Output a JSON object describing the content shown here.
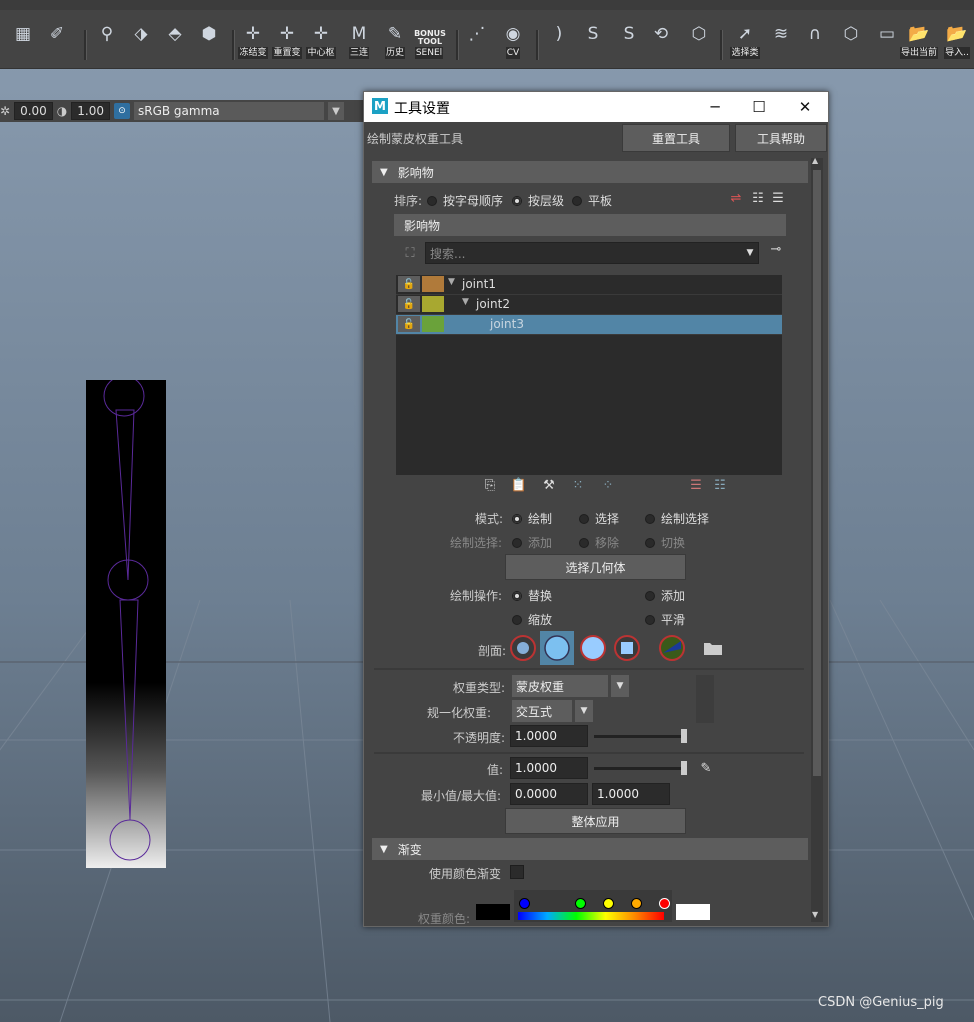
{
  "shelf": {
    "buttons": [
      {
        "icon": "grid-icon",
        "label": ""
      },
      {
        "icon": "paint-brush-icon",
        "label": ""
      },
      {
        "icon": "pivot-icon",
        "label": ""
      },
      {
        "icon": "cube-move-icon",
        "label": ""
      },
      {
        "icon": "plane-icon",
        "label": ""
      },
      {
        "icon": "cube-icon",
        "label": ""
      },
      {
        "icon": "freeze-transform-icon",
        "label": "冻结变"
      },
      {
        "icon": "reset-transform-icon",
        "label": "重置变"
      },
      {
        "icon": "center-pivot-icon",
        "label": "中心枢"
      },
      {
        "icon": "triangulate-icon",
        "label": "三连"
      },
      {
        "icon": "history-icon",
        "label": "历史"
      },
      {
        "icon": "bonus-tools-icon",
        "label": "SENEl"
      },
      {
        "icon": "connect-icon",
        "label": ""
      },
      {
        "icon": "cv-curve-icon",
        "label": "CV"
      },
      {
        "icon": "curve-a-icon",
        "label": ""
      },
      {
        "icon": "curve-b-icon",
        "label": ""
      },
      {
        "icon": "curve-c-icon",
        "label": ""
      },
      {
        "icon": "lasso-icon",
        "label": ""
      },
      {
        "icon": "sculpt-icon",
        "label": ""
      },
      {
        "icon": "select-type-icon",
        "label": "选择类"
      },
      {
        "icon": "ribbon-icon",
        "label": ""
      },
      {
        "icon": "bend-icon",
        "label": ""
      },
      {
        "icon": "lattice-icon",
        "label": ""
      },
      {
        "icon": "camera-icon",
        "label": ""
      },
      {
        "icon": "export-current-icon",
        "label": "导出当前"
      },
      {
        "icon": "import-icon",
        "label": "导入.."
      }
    ],
    "bonus_text": "BONUS TOOL"
  },
  "viewport_toolbar": {
    "exposure": "0.00",
    "gamma": "1.00",
    "color_space": "sRGB gamma"
  },
  "dialog": {
    "title": "工具设置",
    "tool_name": "绘制蒙皮权重工具",
    "reset_tool": "重置工具",
    "tool_help": "工具帮助",
    "section_influences": "影响物",
    "sort_label": "排序:",
    "sort_options": [
      "按字母顺序",
      "按层级",
      "平板"
    ],
    "sub_influences": "影响物",
    "search_placeholder": "搜索...",
    "joints": [
      {
        "name": "joint1",
        "color": "#b07a3a"
      },
      {
        "name": "joint2",
        "color": "#a8a830"
      },
      {
        "name": "joint3",
        "color": "#6aa23a"
      }
    ],
    "mode_label": "模式:",
    "mode_options": [
      "绘制",
      "选择",
      "绘制选择"
    ],
    "paint_select_label": "绘制选择:",
    "paint_select_options": [
      "添加",
      "移除",
      "切换"
    ],
    "select_geometry": "选择几何体",
    "paint_op_label": "绘制操作:",
    "paint_op_options": [
      "替换",
      "添加",
      "缩放",
      "平滑"
    ],
    "profile_label": "剖面:",
    "weight_type_label": "权重类型:",
    "weight_type_value": "蒙皮权重",
    "normalize_label": "规一化权重:",
    "normalize_value": "交互式",
    "opacity_label": "不透明度:",
    "opacity_value": "1.0000",
    "value_label": "值:",
    "value_value": "1.0000",
    "minmax_label": "最小值/最大值:",
    "min_value": "0.0000",
    "max_value": "1.0000",
    "flood": "整体应用",
    "section_gradient": "渐变",
    "use_color_ramp": "使用颜色渐变",
    "weight_color": "权重颜色:"
  },
  "watermark": "CSDN @Genius_pig"
}
